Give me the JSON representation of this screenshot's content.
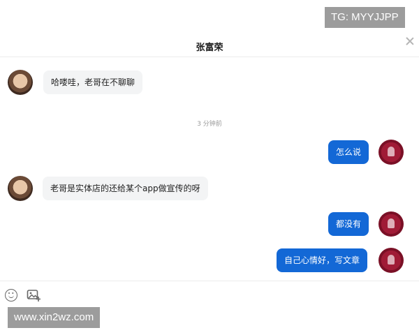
{
  "window": {
    "title": "张富荣"
  },
  "messages": [
    {
      "from": "them",
      "text": "哈喽哇，老哥在不聊聊"
    },
    {
      "from": "me",
      "text": "怎么说"
    },
    {
      "from": "them",
      "text": "老哥是实体店的还给某个app做宣传的呀"
    },
    {
      "from": "me",
      "text": "都没有"
    },
    {
      "from": "me",
      "text": "自己心情好，写文章"
    }
  ],
  "time_divider": "3 分钟前",
  "input_bar": {
    "icons": [
      "emoji-icon",
      "image-icon"
    ]
  },
  "watermarks": {
    "top": "TG: MYYJJPP",
    "bottom": "www.xin2wz.com"
  },
  "colors": {
    "my_bubble": "#1368d6",
    "their_bubble": "#f3f4f5",
    "watermark_bg": "#9c9c9c"
  }
}
